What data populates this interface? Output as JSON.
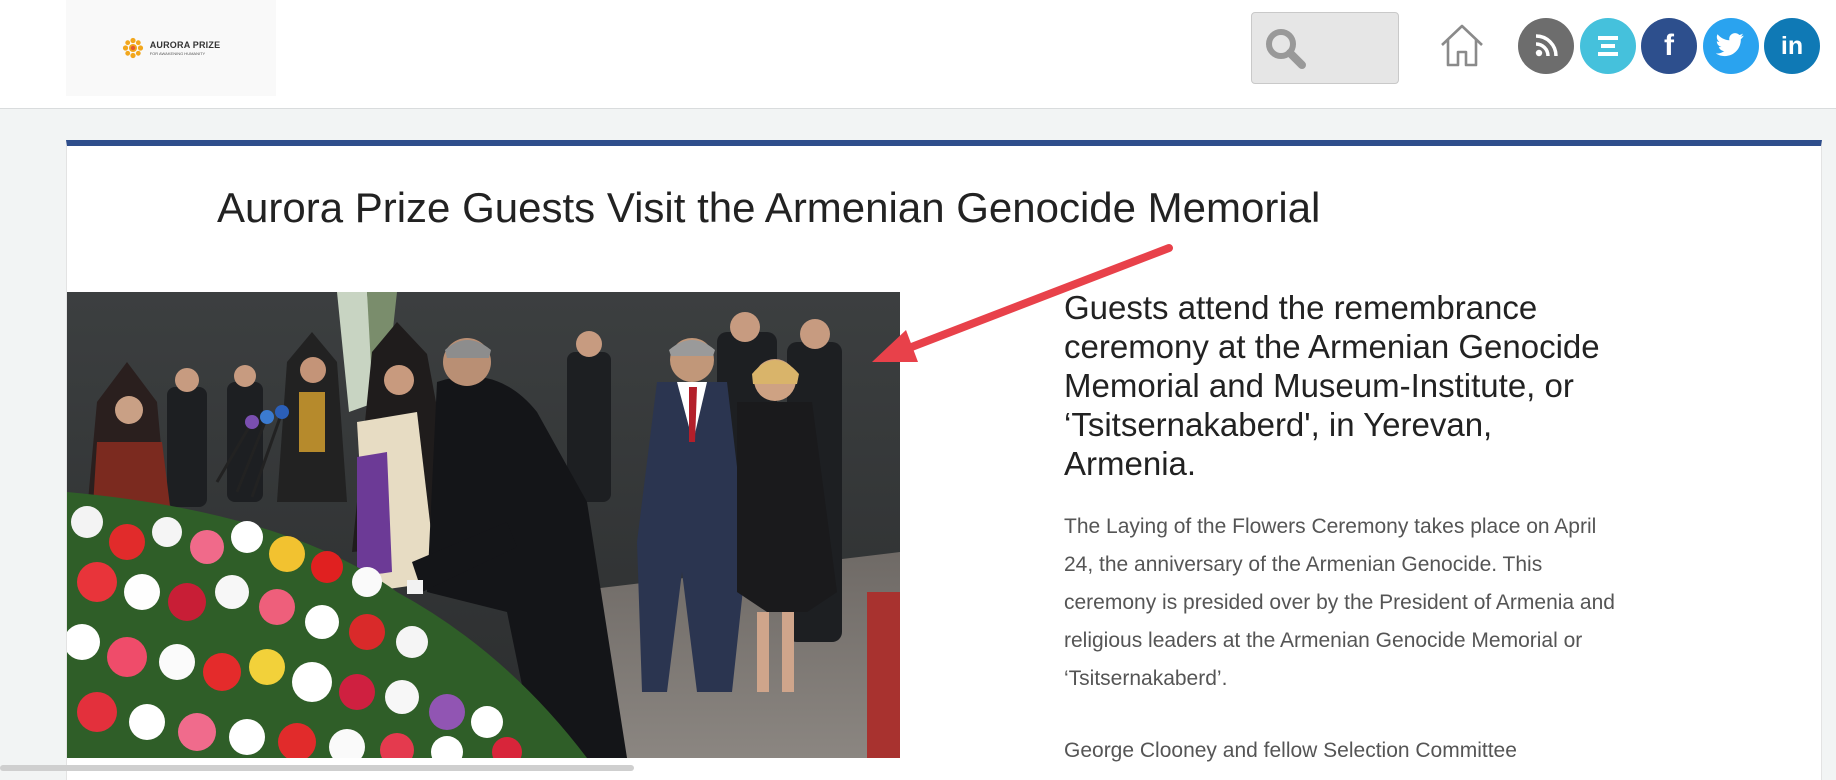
{
  "header": {
    "logo": {
      "name": "AURORA PRIZE",
      "tagline": "FOR AWAKENING HUMANITY"
    },
    "search": {
      "value": "",
      "placeholder": ""
    },
    "icons": [
      "search-icon",
      "home-icon",
      "rss-icon",
      "blog-icon",
      "facebook-icon",
      "twitter-icon",
      "linkedin-icon"
    ],
    "social_colors": {
      "rss": "#6d6d6d",
      "blog": "#45c1dc",
      "facebook": "#2d4f8d",
      "twitter": "#2aa3ef",
      "linkedin": "#0f79b5"
    }
  },
  "article": {
    "accent_color": "#2f4e8c",
    "title": "Aurora Prize Guests Visit the Armenian Genocide Memorial",
    "subheading": "Guests attend the remembrance ceremony at the Armenian Genocide Memorial and Museum-Institute, or ‘Tsitsernakaberd', in Yerevan, Armenia.",
    "paragraph1": "The Laying of the Flowers Ceremony takes place on April 24, the anniversary of the Armenian Genocide. This ceremony is presided over by the President of Armenia and  religious leaders at the Armenian Genocide Memorial or ‘Tsitsernakaberd’.",
    "paragraph2": "George Clooney and fellow Selection Committee"
  },
  "annotation": {
    "arrow_color": "#e8414a"
  }
}
